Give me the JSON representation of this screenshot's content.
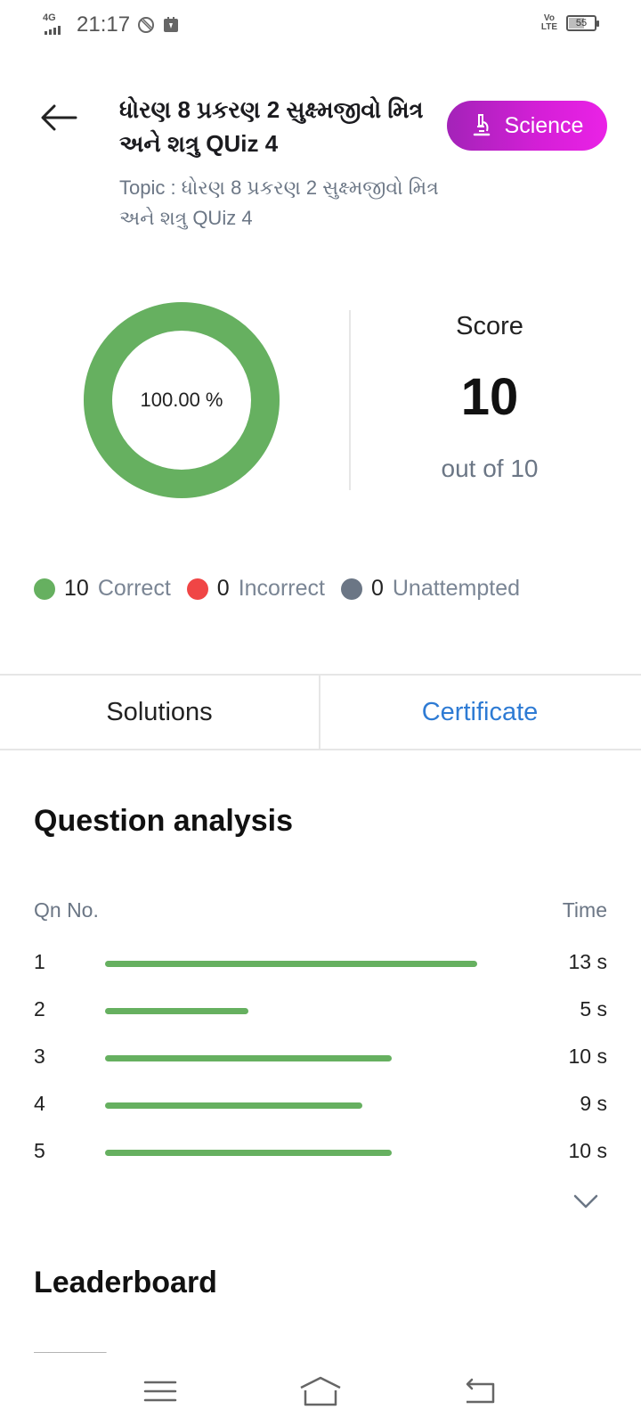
{
  "status_bar": {
    "network": "4G",
    "time": "21:17",
    "volte": "Vo LTE",
    "battery": "55"
  },
  "header": {
    "title": "ધોરણ 8 પ્રકરણ 2 સુક્ષ્મજીવો મિત્ર અને શત્રુ QUiz 4",
    "topic_label": "Topic :",
    "topic_value": "ધોરણ 8 પ્રકરણ 2 સુક્ષ્મજીવો મિત્ર અને શત્રુ QUiz 4",
    "subject": "Science",
    "subject_icon": "microscope-icon"
  },
  "result": {
    "percent_text": "100.00 %",
    "percent": 1.0,
    "score_label": "Score",
    "score": "10",
    "out_of": "out of 10",
    "ring_color": "#66b060"
  },
  "legend": [
    {
      "count": "10",
      "label": "Correct",
      "color": "#66b060"
    },
    {
      "count": "0",
      "label": "Incorrect",
      "color": "#f04545"
    },
    {
      "count": "0",
      "label": "Unattempted",
      "color": "#6b7685"
    }
  ],
  "tabs": {
    "solutions": "Solutions",
    "certificate": "Certificate"
  },
  "question_analysis": {
    "title": "Question analysis",
    "col_question": "Qn No.",
    "col_time": "Time",
    "max_seconds": 13,
    "rows": [
      {
        "qn": "1",
        "time": "13 s",
        "seconds": 13
      },
      {
        "qn": "2",
        "time": "5 s",
        "seconds": 5
      },
      {
        "qn": "3",
        "time": "10 s",
        "seconds": 10
      },
      {
        "qn": "4",
        "time": "9 s",
        "seconds": 9
      },
      {
        "qn": "5",
        "time": "10 s",
        "seconds": 10
      }
    ]
  },
  "leaderboard": {
    "title": "Leaderboard"
  },
  "nav": {
    "menu_icon": "menu-icon",
    "home_icon": "home-icon",
    "back_icon": "back-icon"
  }
}
